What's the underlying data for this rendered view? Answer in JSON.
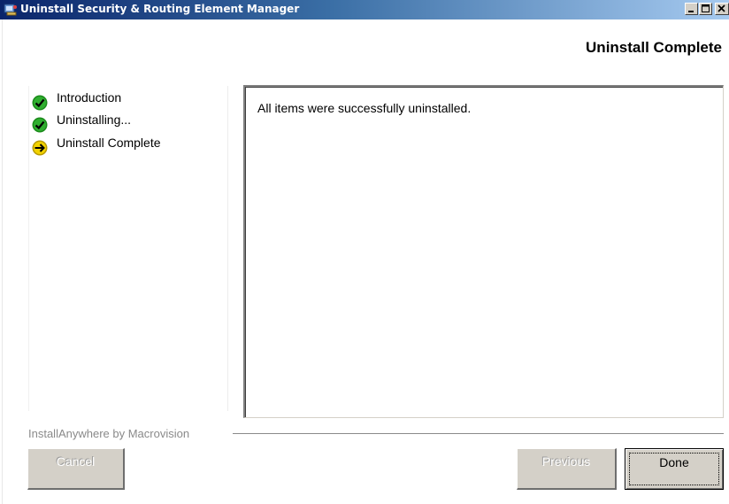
{
  "window": {
    "title": "Uninstall Security & Routing Element Manager",
    "icon": "installer-app-icon",
    "controls": [
      "minimize-icon",
      "maximize-icon",
      "close-icon"
    ]
  },
  "header": {
    "title": "Uninstall Complete"
  },
  "steps": [
    {
      "label": "Introduction",
      "status": "done",
      "icon": "green-check-icon"
    },
    {
      "label": "Uninstalling...",
      "status": "done",
      "icon": "green-check-icon"
    },
    {
      "label": "Uninstall Complete",
      "status": "current",
      "icon": "yellow-arrow-icon"
    }
  ],
  "content": {
    "message": "All items were successfully uninstalled."
  },
  "footer": {
    "brand": "InstallAnywhere by Macrovision",
    "cancel_label": "Cancel",
    "previous_label": "Previous",
    "done_label": "Done"
  },
  "colors": {
    "titlebar_start": "#0a246a",
    "titlebar_end": "#a6caf0",
    "button_face": "#d4d0c8",
    "check_green": "#1a8a1a",
    "arrow_yellow": "#f2d200"
  }
}
